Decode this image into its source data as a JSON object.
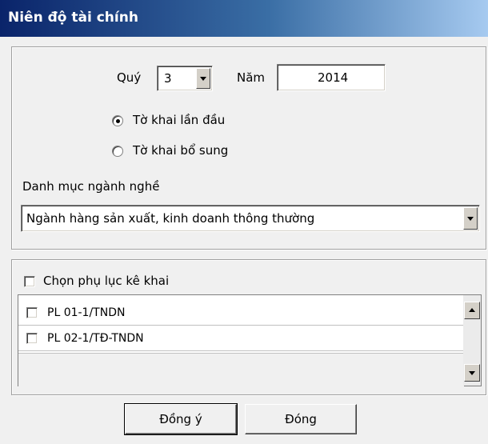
{
  "window": {
    "title": "Niên độ tài chính"
  },
  "period": {
    "quarter_label": "Quý",
    "quarter_value": "3",
    "year_label": "Năm",
    "year_value": "2014"
  },
  "declaration_type": {
    "options": [
      {
        "label": "Tờ khai lần đầu",
        "selected": true
      },
      {
        "label": "Tờ khai bổ sung",
        "selected": false
      }
    ]
  },
  "industry": {
    "label": "Danh mục ngành nghề",
    "selected": "Ngành hàng sản xuất, kinh doanh thông thường"
  },
  "appendix": {
    "select_label": "Chọn phụ lục kê khai",
    "items": [
      {
        "label": "PL 01-1/TNDN",
        "checked": false
      },
      {
        "label": "PL 02-1/TĐ-TNDN",
        "checked": false
      }
    ]
  },
  "buttons": {
    "ok": "Đồng ý",
    "close": "Đóng"
  }
}
